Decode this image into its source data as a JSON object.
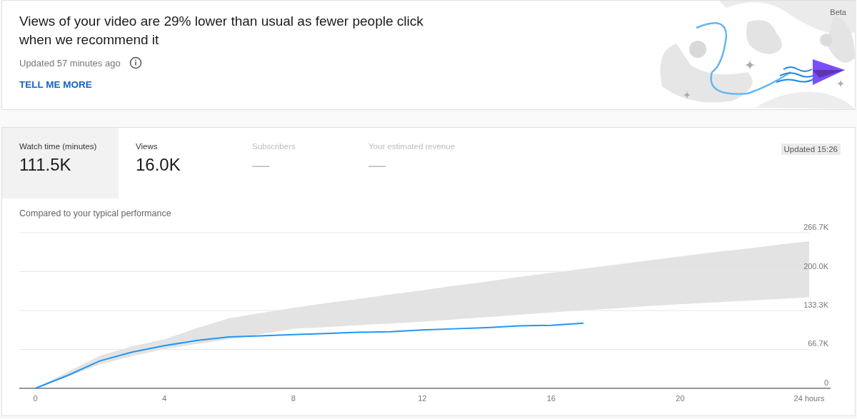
{
  "insight": {
    "headline": "Views of your video are 29% lower than usual as fewer people click when we recommend it",
    "updated": "Updated 57 minutes ago",
    "action": "TELL ME MORE",
    "badge": "Beta"
  },
  "metrics": [
    {
      "label": "Watch time (minutes)",
      "value": "111.5K",
      "selected": true,
      "disabled": false
    },
    {
      "label": "Views",
      "value": "16.0K",
      "selected": false,
      "disabled": false
    },
    {
      "label": "Subscribers",
      "value": "—",
      "selected": false,
      "disabled": true
    },
    {
      "label": "Your estimated revenue",
      "value": "—",
      "selected": false,
      "disabled": true
    }
  ],
  "updated_chip": "Updated 15:26",
  "chart_caption": "Compared to your typical performance",
  "chart_data": {
    "type": "line",
    "x": [
      0,
      1,
      2,
      3,
      4,
      5,
      6,
      7,
      8,
      9,
      10,
      11,
      12,
      13,
      14,
      15,
      16,
      17,
      18,
      19,
      20,
      21,
      22,
      23,
      24
    ],
    "ylim": [
      0,
      266.7
    ],
    "xlim": [
      -0.5,
      24
    ],
    "grid": true,
    "xticks": [
      0,
      4,
      8,
      12,
      16,
      20,
      {
        "value": 24,
        "label": "24 hours"
      }
    ],
    "yticks": [
      {
        "value": 0,
        "label": "0"
      },
      {
        "value": 66.7,
        "label": "66.7K"
      },
      {
        "value": 133.3,
        "label": "133.3K"
      },
      {
        "value": 200,
        "label": "200.0K"
      },
      {
        "value": 266.7,
        "label": "266.7K"
      }
    ],
    "series": [
      {
        "type": "area",
        "color": "#e3e3e3",
        "values": [
          0,
          28,
          56,
          72,
          84,
          103,
          120,
          129,
          138,
          146,
          153,
          161,
          168,
          176,
          183,
          191,
          198,
          205,
          212,
          219,
          226,
          233,
          239,
          246,
          252
        ]
      },
      {
        "type": "area",
        "color": "#ffffff",
        "values": [
          0,
          20,
          41,
          55,
          67,
          76,
          84,
          93,
          102,
          105,
          108,
          111,
          114,
          118,
          122,
          126,
          130,
          134,
          137,
          141,
          144,
          147,
          150,
          153,
          156
        ]
      },
      {
        "type": "line",
        "color": "#2196f3",
        "values": [
          0,
          22,
          47,
          62,
          73,
          82,
          88,
          90,
          92,
          94,
          96,
          97,
          100,
          102,
          104,
          107,
          108,
          111.5,
          null,
          null,
          null,
          null,
          null,
          null,
          null
        ]
      }
    ]
  }
}
